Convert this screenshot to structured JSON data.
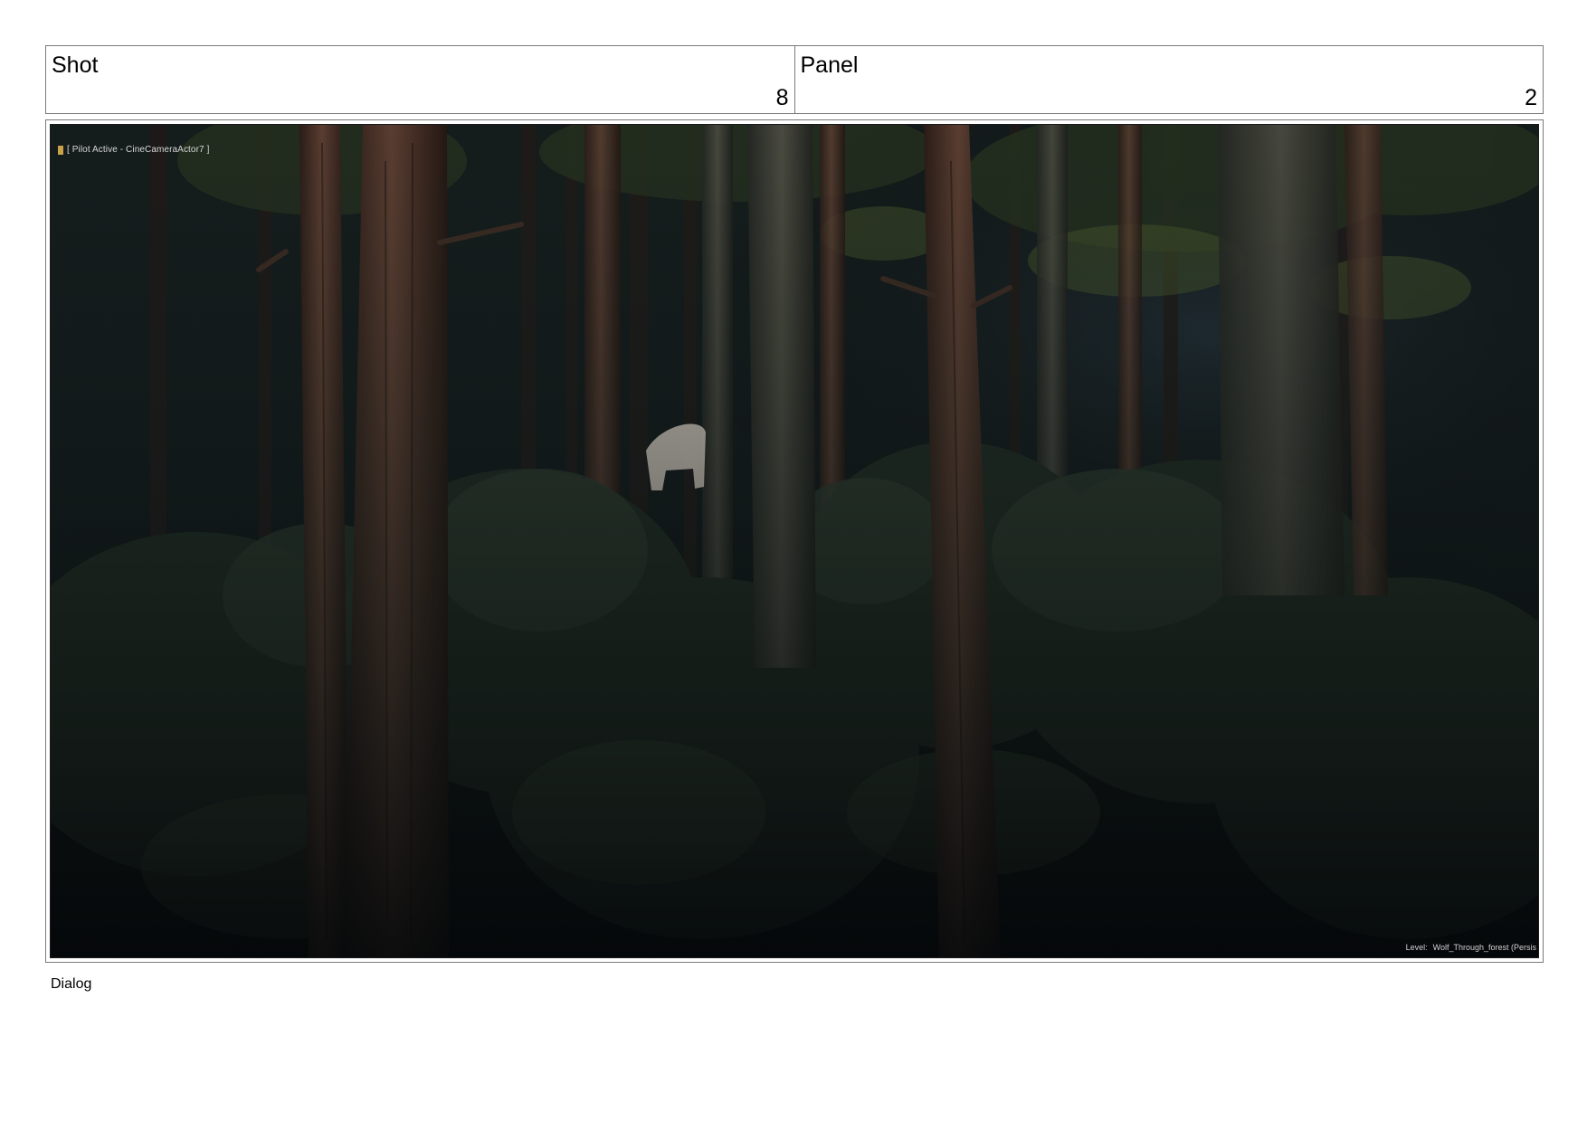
{
  "header": {
    "shot_label": "Shot",
    "shot_value": "8",
    "panel_label": "Panel",
    "panel_value": "2"
  },
  "frame": {
    "pilot_text": "[ Pilot Active - CineCameraActor7 ]",
    "level_label": "Level:",
    "level_value": "Wolf_Through_forest (Persis"
  },
  "footer": {
    "dialog_label": "Dialog"
  },
  "colors": {
    "border": "#7a7a7a",
    "scene_dark": "#0b0f0d",
    "trunk": "#4a3228",
    "foliage": "#1f2a22",
    "figure": "#d9cfc4"
  }
}
